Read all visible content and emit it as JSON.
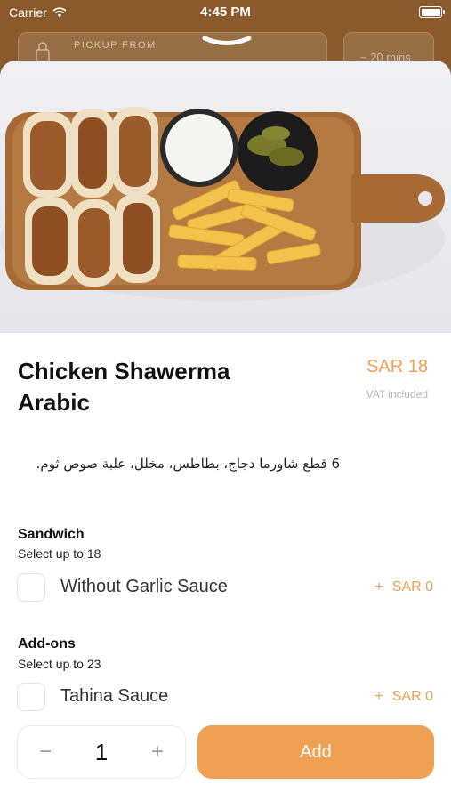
{
  "status_bar": {
    "carrier": "Carrier",
    "time": "4:45 PM"
  },
  "header": {
    "pickup_label": "PICKUP FROM",
    "time_label": "~ 20 mins"
  },
  "item": {
    "name_line1": "Chicken Shawerma",
    "name_line2": "Arabic",
    "price": "SAR 18",
    "vat_note": "VAT included",
    "description": "6 قطع شاورما دجاج، بطاطس، مخلل، علبة صوص ثوم."
  },
  "groups": [
    {
      "title": "Sandwich",
      "subtitle": "Select up to 18",
      "options": [
        {
          "label": "Without Garlic Sauce",
          "plus": "+",
          "price": "SAR 0"
        }
      ]
    },
    {
      "title": "Add-ons",
      "subtitle": "Select up to 23",
      "options": [
        {
          "label": "Tahina Sauce",
          "plus": "+",
          "price": "SAR 0"
        }
      ]
    }
  ],
  "footer": {
    "minus": "−",
    "quantity": "1",
    "plus": "+",
    "add_label": "Add"
  },
  "colors": {
    "accent": "#f0a053",
    "header_bg": "#8a5a2c"
  }
}
